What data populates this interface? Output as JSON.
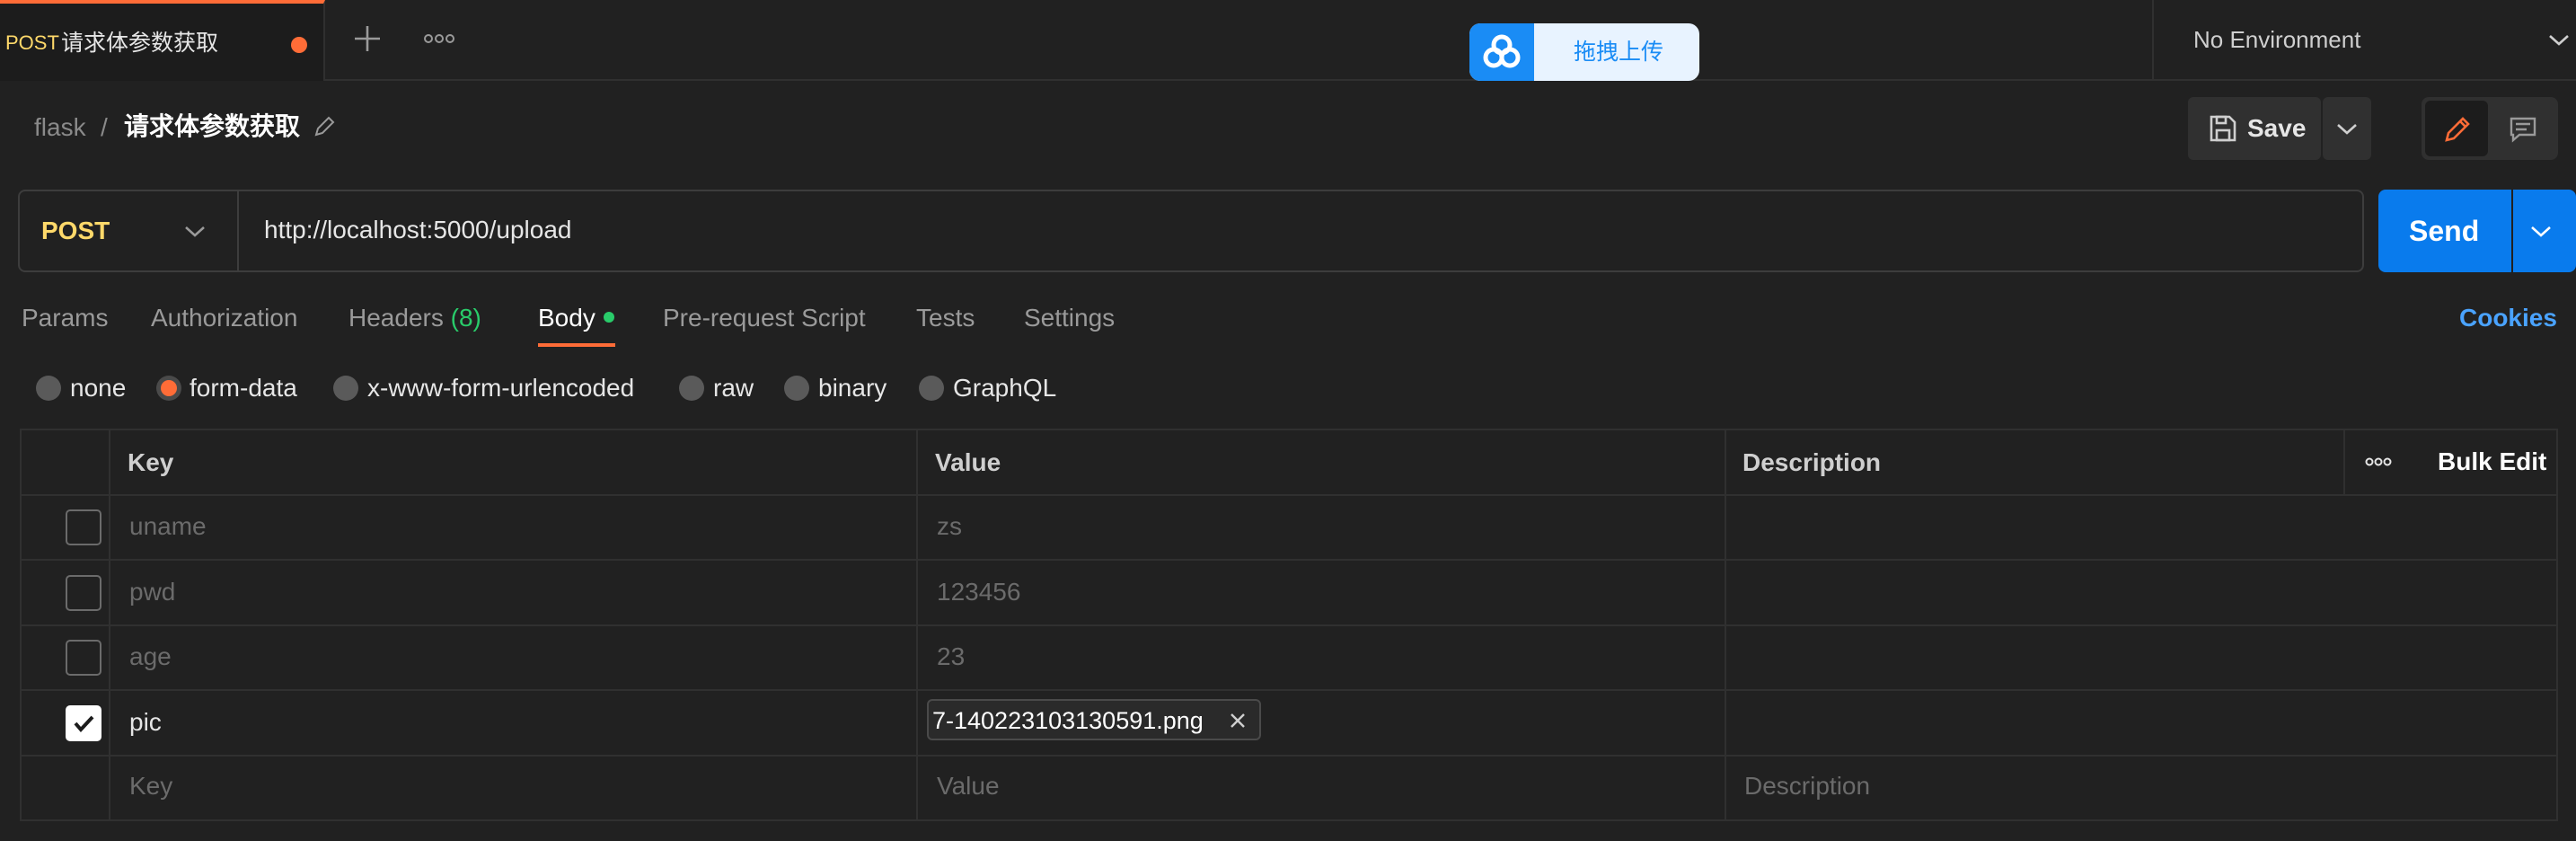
{
  "tab": {
    "method": "POST",
    "title": "请求体参数获取"
  },
  "upload_widget": {
    "label": "拖拽上传"
  },
  "environment": {
    "selected": "No Environment"
  },
  "breadcrumb": {
    "collection": "flask",
    "separator": "/",
    "request": "请求体参数获取"
  },
  "toolbar": {
    "save_label": "Save"
  },
  "request": {
    "method": "POST",
    "url": "http://localhost:5000/upload",
    "send_label": "Send"
  },
  "req_tabs": {
    "params": "Params",
    "authorization": "Authorization",
    "headers": "Headers",
    "headers_count": "(8)",
    "body": "Body",
    "pre_request": "Pre-request Script",
    "tests": "Tests",
    "settings": "Settings",
    "cookies": "Cookies"
  },
  "body_types": {
    "none": "none",
    "form_data": "form-data",
    "urlencoded": "x-www-form-urlencoded",
    "raw": "raw",
    "binary": "binary",
    "graphql": "GraphQL",
    "selected": "form-data"
  },
  "table": {
    "headers": {
      "key": "Key",
      "value": "Value",
      "description": "Description",
      "more": "ooo",
      "bulk_edit": "Bulk Edit"
    },
    "rows": [
      {
        "checked": false,
        "key": "uname",
        "value": "zs",
        "description": ""
      },
      {
        "checked": false,
        "key": "pwd",
        "value": "123456",
        "description": ""
      },
      {
        "checked": false,
        "key": "age",
        "value": "23",
        "description": ""
      },
      {
        "checked": true,
        "key": "pic",
        "value": "7-140223103130591.png",
        "description": ""
      }
    ],
    "placeholders": {
      "key": "Key",
      "value": "Value",
      "description": "Description"
    }
  },
  "colors": {
    "accent": "#ff6c37",
    "send": "#097bed",
    "method": "#ffd96a",
    "success": "#29cc6a",
    "link": "#4aa3ff"
  }
}
